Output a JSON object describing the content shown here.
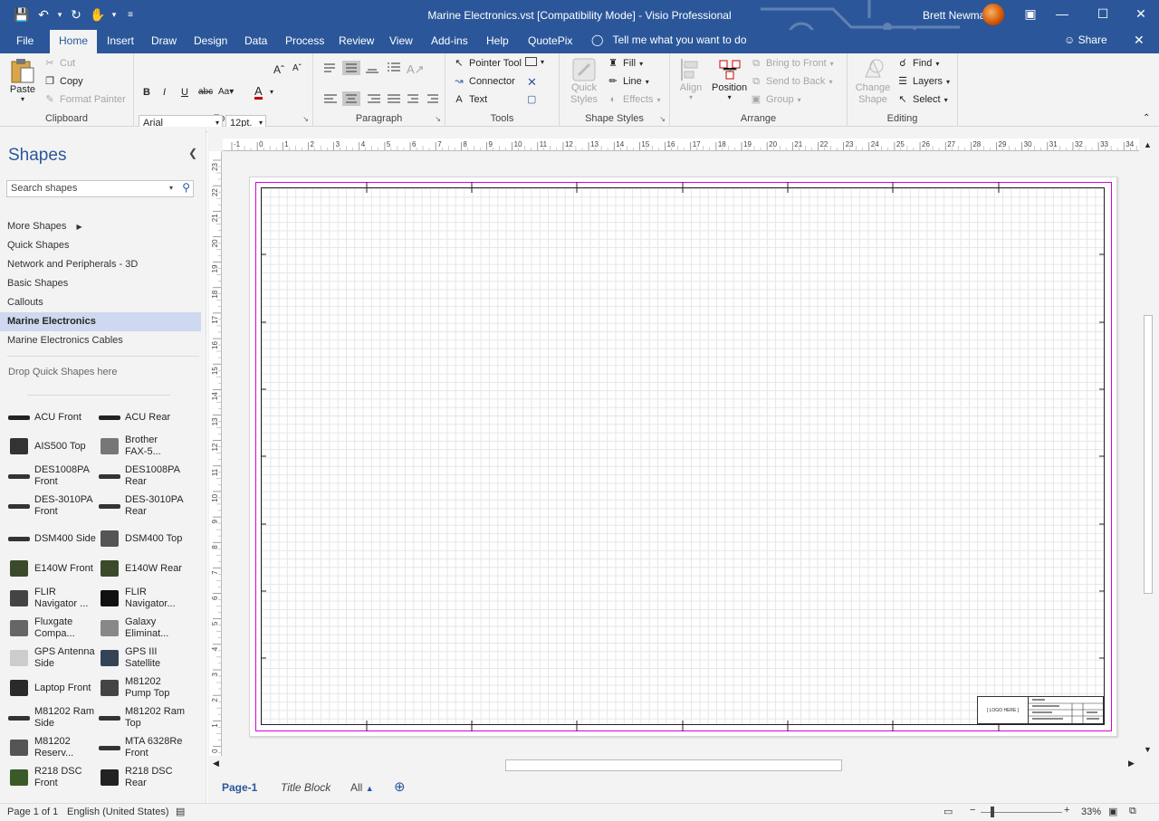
{
  "window": {
    "title": "Marine Electronics.vst  [Compatibility Mode]  -  Visio Professional",
    "user": "Brett Newman"
  },
  "tabs": [
    "File",
    "Home",
    "Insert",
    "Draw",
    "Design",
    "Data",
    "Process",
    "Review",
    "View",
    "Add-ins",
    "Help",
    "QuotePix"
  ],
  "tellme": "Tell me what you want to do",
  "share": "Share",
  "ribbon": {
    "clipboard": {
      "label": "Clipboard",
      "paste": "Paste",
      "cut": "Cut",
      "copy": "Copy",
      "format_painter": "Format Painter"
    },
    "font": {
      "label": "Font",
      "family": "Arial",
      "size": "12pt."
    },
    "paragraph": {
      "label": "Paragraph"
    },
    "tools": {
      "label": "Tools",
      "pointer": "Pointer Tool",
      "connector": "Connector",
      "text": "Text"
    },
    "shape_styles": {
      "label": "Shape Styles",
      "quick_styles": "Quick Styles",
      "fill": "Fill",
      "line": "Line",
      "effects": "Effects"
    },
    "arrange": {
      "label": "Arrange",
      "align": "Align",
      "position": "Position",
      "bring_front": "Bring to Front",
      "send_back": "Send to Back",
      "group": "Group"
    },
    "editing": {
      "label": "Editing",
      "change_shape": "Change Shape",
      "find": "Find",
      "layers": "Layers",
      "select": "Select"
    }
  },
  "shapes_panel": {
    "title": "Shapes",
    "search_placeholder": "Search shapes",
    "stencils": [
      "More Shapes",
      "Quick Shapes",
      "Network and Peripherals - 3D",
      "Basic Shapes",
      "Callouts",
      "Marine Electronics",
      "Marine Electronics Cables"
    ],
    "selected_stencil": "Marine Electronics",
    "drop_hint": "Drop Quick Shapes here",
    "shapes": [
      {
        "l1": "ACU Front",
        "l2": ""
      },
      {
        "l1": "ACU Rear",
        "l2": ""
      },
      {
        "l1": "AIS500 Top",
        "l2": ""
      },
      {
        "l1": "Brother",
        "l2": "FAX-5..."
      },
      {
        "l1": "DES1008PA",
        "l2": "Front"
      },
      {
        "l1": "DES1008PA",
        "l2": "Rear"
      },
      {
        "l1": "DES-3010PA",
        "l2": "Front"
      },
      {
        "l1": "DES-3010PA",
        "l2": "Rear"
      },
      {
        "l1": "DSM400 Side",
        "l2": ""
      },
      {
        "l1": "DSM400 Top",
        "l2": ""
      },
      {
        "l1": "E140W Front",
        "l2": ""
      },
      {
        "l1": "E140W Rear",
        "l2": ""
      },
      {
        "l1": "FLIR",
        "l2": "Navigator ..."
      },
      {
        "l1": "FLIR",
        "l2": "Navigator..."
      },
      {
        "l1": "Fluxgate",
        "l2": "Compa..."
      },
      {
        "l1": "Galaxy",
        "l2": "Eliminat..."
      },
      {
        "l1": "GPS Antenna",
        "l2": "Side"
      },
      {
        "l1": "GPS III",
        "l2": "Satellite"
      },
      {
        "l1": "Laptop Front",
        "l2": ""
      },
      {
        "l1": "M81202",
        "l2": "Pump Top"
      },
      {
        "l1": "M81202 Ram",
        "l2": "Side"
      },
      {
        "l1": "M81202 Ram",
        "l2": "Top"
      },
      {
        "l1": "M81202",
        "l2": "Reserv..."
      },
      {
        "l1": "MTA 6328Re",
        "l2": "Front"
      },
      {
        "l1": "R218 DSC",
        "l2": "Front"
      },
      {
        "l1": "R218 DSC",
        "l2": "Rear"
      }
    ]
  },
  "ruler": {
    "top": [
      "-1",
      "0",
      "1",
      "2",
      "3",
      "4",
      "5",
      "6",
      "7",
      "8",
      "9",
      "10",
      "11",
      "12",
      "13",
      "14",
      "15",
      "16",
      "17",
      "18",
      "19",
      "20",
      "21",
      "22",
      "23",
      "24",
      "25",
      "26",
      "27",
      "28",
      "29",
      "30",
      "31",
      "32",
      "33",
      "34"
    ],
    "left": [
      "23",
      "22",
      "21",
      "20",
      "19",
      "18",
      "17",
      "16",
      "15",
      "14",
      "13",
      "12",
      "11",
      "10",
      "9",
      "8",
      "7",
      "6",
      "5",
      "4",
      "3",
      "2",
      "1",
      "0"
    ]
  },
  "titleblock_logo": "[ LOGO HERE ]",
  "page_tabs": {
    "pages": [
      "Page-1",
      "Title Block"
    ],
    "all": "All"
  },
  "status": {
    "page": "Page 1 of 1",
    "language": "English (United States)",
    "zoom": "33%"
  }
}
